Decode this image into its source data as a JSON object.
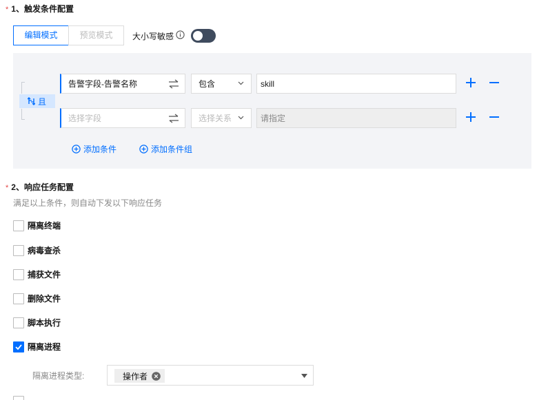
{
  "section1": {
    "required_mark": "*",
    "title": "1、触发条件配置",
    "tabs": [
      {
        "label": "编辑模式",
        "active": true
      },
      {
        "label": "预览模式",
        "active": false
      }
    ],
    "case_sensitive_label": "大小写敏感",
    "case_sensitive_on": false,
    "logic_operator": "且",
    "conditions": [
      {
        "field": "告警字段-告警名称",
        "field_placeholder": "选择字段",
        "relation": "包含",
        "relation_placeholder": "选择关系",
        "value": "skill",
        "value_placeholder": "请指定"
      },
      {
        "field": "",
        "field_placeholder": "选择字段",
        "relation": "",
        "relation_placeholder": "选择关系",
        "value": "",
        "value_placeholder": "请指定"
      }
    ],
    "add_condition_label": "添加条件",
    "add_condition_group_label": "添加条件组"
  },
  "section2": {
    "required_mark": "*",
    "title": "2、响应任务配置",
    "description": "满足以上条件，则自动下发以下响应任务",
    "tasks": [
      {
        "label": "隔离终端",
        "checked": false
      },
      {
        "label": "病毒查杀",
        "checked": false
      },
      {
        "label": "捕获文件",
        "checked": false
      },
      {
        "label": "删除文件",
        "checked": false
      },
      {
        "label": "脚本执行",
        "checked": false
      },
      {
        "label": "隔离进程",
        "checked": true
      }
    ],
    "process_type_label": "隔离进程类型:",
    "process_type_selected": [
      "操作者"
    ]
  },
  "colors": {
    "accent": "#006eff",
    "required": "#e54545",
    "panel_bg": "#f3f4f7",
    "toggle_off": "#3f4b5e"
  }
}
